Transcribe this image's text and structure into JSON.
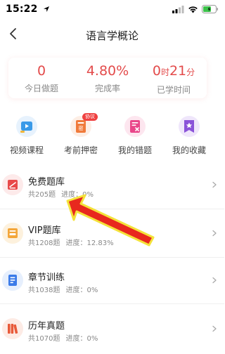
{
  "status_bar": {
    "time": "15:22"
  },
  "nav": {
    "title": "语言学概论"
  },
  "stats": [
    {
      "value_main": "0",
      "value_unit": "",
      "value_tail": "",
      "label": "今日做题"
    },
    {
      "value_main": "4.80%",
      "value_unit": "",
      "value_tail": "",
      "label": "完成率"
    },
    {
      "value_main": "0",
      "value_unit": "时",
      "value_tail": "21",
      "value_tail_unit": "分",
      "label": "已学时间"
    }
  ],
  "actions": [
    {
      "label": "视频课程",
      "icon": "video-icon",
      "color": "#3a9ae8"
    },
    {
      "label": "考前押密",
      "icon": "secret-icon",
      "color": "#f07a3a",
      "badge": "协议"
    },
    {
      "label": "我的错题",
      "icon": "wrong-icon",
      "color": "#e9468a"
    },
    {
      "label": "我的收藏",
      "icon": "favorite-icon",
      "color": "#8a52d9"
    }
  ],
  "list": [
    {
      "title": "免费题库",
      "count": "共205题",
      "progress": "进度：0%",
      "icon": "free-bank-icon",
      "color": "#e84a4a"
    },
    {
      "title": "VIP题库",
      "count": "共1208题",
      "progress": "进度：12.83%",
      "icon": "vip-bank-icon",
      "color": "#f3a63a"
    },
    {
      "title": "章节训练",
      "count": "共1038题",
      "progress": "进度：0%",
      "icon": "chapter-icon",
      "color": "#3b7be8"
    },
    {
      "title": "历年真题",
      "count": "共1070题",
      "progress": "进度：0%",
      "icon": "past-exam-icon",
      "color": "#e85a3a"
    }
  ]
}
